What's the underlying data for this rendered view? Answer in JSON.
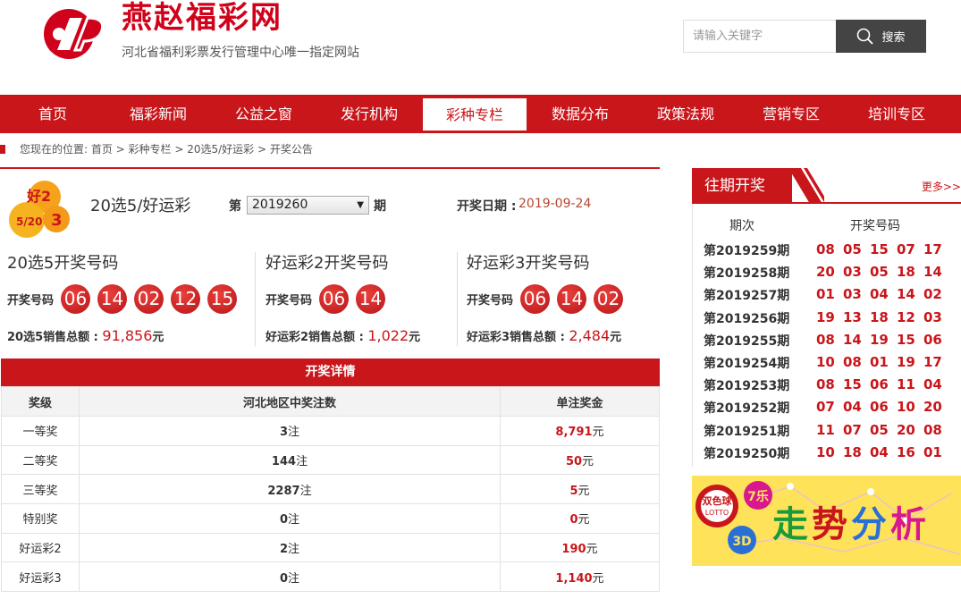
{
  "header": {
    "site_title": "燕赵福彩网",
    "site_subtitle": "河北省福利彩票发行管理中心唯一指定网站",
    "search_placeholder": "请输入关键字",
    "search_button": "搜索"
  },
  "nav": [
    "首页",
    "福彩新闻",
    "公益之窗",
    "发行机构",
    "彩种专栏",
    "数据分布",
    "政策法规",
    "营销专区",
    "培训专区"
  ],
  "nav_active_index": 4,
  "breadcrumb": "您现在的位置: 首页 > 彩种专栏 > 20选5/好运彩 > 开奖公告",
  "game": {
    "icon_text_top": "好2",
    "icon_text_bottom": "5/20",
    "icon_text_right": "3",
    "name": "20选5/好运彩",
    "period_prefix": "第",
    "period_value": "2019260",
    "period_suffix": "期",
    "date_label": "开奖日期 :",
    "date_value": "2019-09-24"
  },
  "results": [
    {
      "title": "20选5开奖号码",
      "label": "开奖号码",
      "balls": [
        "06",
        "14",
        "02",
        "12",
        "15"
      ],
      "sales_label": "20选5销售总额 :",
      "sales_amount": "91,856",
      "sales_unit": "元"
    },
    {
      "title": "好运彩2开奖号码",
      "label": "开奖号码",
      "balls": [
        "06",
        "14"
      ],
      "sales_label": "好运彩2销售总额 :",
      "sales_amount": "1,022",
      "sales_unit": "元"
    },
    {
      "title": "好运彩3开奖号码",
      "label": "开奖号码",
      "balls": [
        "06",
        "14",
        "02"
      ],
      "sales_label": "好运彩3销售总额 :",
      "sales_amount": "2,484",
      "sales_unit": "元"
    }
  ],
  "detail": {
    "title": "开奖详情",
    "headers": [
      "奖级",
      "河北地区中奖注数",
      "单注奖金"
    ],
    "count_unit": "注",
    "amount_unit": "元",
    "rows": [
      {
        "level": "一等奖",
        "count": "3",
        "amount": "8,791"
      },
      {
        "level": "二等奖",
        "count": "144",
        "amount": "50"
      },
      {
        "level": "三等奖",
        "count": "2287",
        "amount": "5"
      },
      {
        "level": "特别奖",
        "count": "0",
        "amount": "0"
      },
      {
        "level": "好运彩2",
        "count": "2",
        "amount": "190"
      },
      {
        "level": "好运彩3",
        "count": "0",
        "amount": "1,140"
      }
    ]
  },
  "past": {
    "title": "往期开奖",
    "more": "更多>>",
    "col_period": "期次",
    "col_numbers": "开奖号码",
    "rows": [
      {
        "period": "第2019259期",
        "nums": [
          "08",
          "05",
          "15",
          "07",
          "17"
        ]
      },
      {
        "period": "第2019258期",
        "nums": [
          "20",
          "03",
          "05",
          "18",
          "14"
        ]
      },
      {
        "period": "第2019257期",
        "nums": [
          "01",
          "03",
          "04",
          "14",
          "02"
        ]
      },
      {
        "period": "第2019256期",
        "nums": [
          "19",
          "13",
          "18",
          "12",
          "03"
        ]
      },
      {
        "period": "第2019255期",
        "nums": [
          "08",
          "14",
          "19",
          "15",
          "06"
        ]
      },
      {
        "period": "第2019254期",
        "nums": [
          "10",
          "08",
          "01",
          "19",
          "17"
        ]
      },
      {
        "period": "第2019253期",
        "nums": [
          "08",
          "15",
          "06",
          "11",
          "04"
        ]
      },
      {
        "period": "第2019252期",
        "nums": [
          "07",
          "04",
          "06",
          "10",
          "20"
        ]
      },
      {
        "period": "第2019251期",
        "nums": [
          "11",
          "07",
          "05",
          "20",
          "08"
        ]
      },
      {
        "period": "第2019250期",
        "nums": [
          "10",
          "18",
          "04",
          "16",
          "01"
        ]
      }
    ]
  },
  "banner": {
    "text": "走势分析",
    "badge1": "双色球",
    "badge2": "LOTTO",
    "badge3": "3D",
    "badge4": "7乐"
  },
  "colors": {
    "brand_red": "#c9161b",
    "amount_red": "#b4472f",
    "banner_yellow": "#fde25a"
  }
}
